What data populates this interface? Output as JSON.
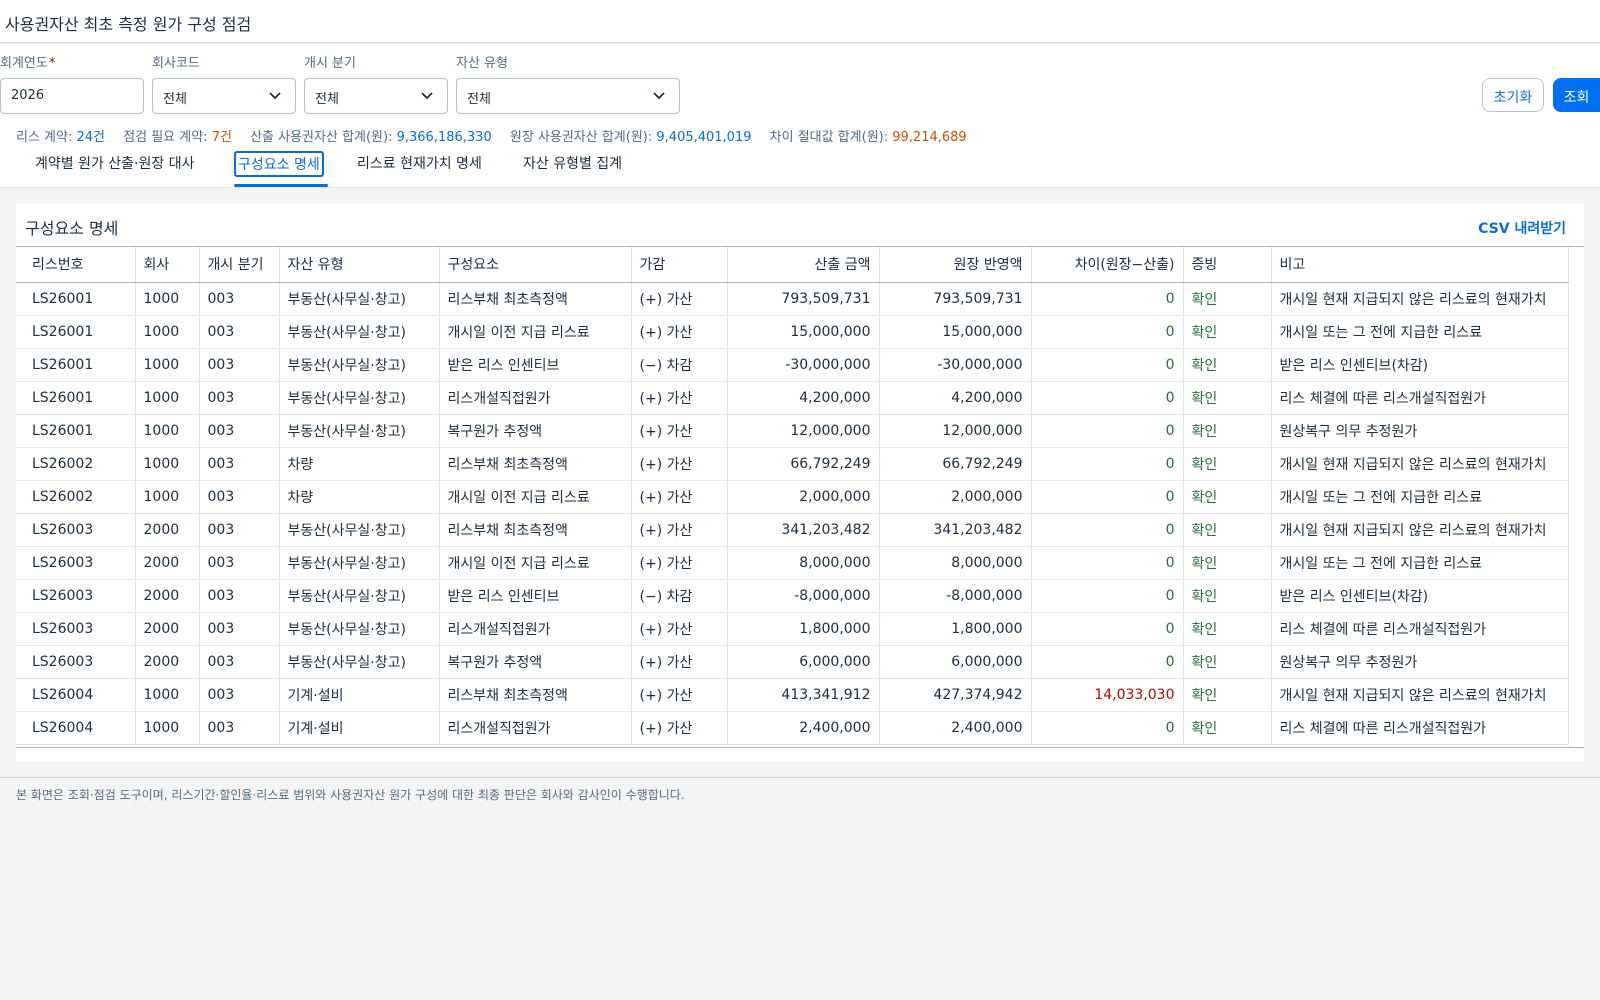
{
  "page": {
    "title": "사용권자산 최초 측정 원가 구성 점검"
  },
  "filters": {
    "year": {
      "label": "회계연도",
      "required_mark": "*",
      "value": "2026"
    },
    "company": {
      "label": "회사코드",
      "value": "전체"
    },
    "quarter": {
      "label": "개시 분기",
      "value": "전체"
    },
    "asset_type": {
      "label": "자산 유형",
      "value": "전체"
    },
    "reset_label": "초기화",
    "search_label": "조회"
  },
  "summary": {
    "contracts_label": "리스 계약:",
    "contracts_value": "24건",
    "check_label": "점검 필요 계약:",
    "check_value": "7건",
    "computed_label": "산출 사용권자산 합계(원):",
    "computed_value": "9,366,186,330",
    "ledger_label": "원장 사용권자산 합계(원):",
    "ledger_value": "9,405,401,019",
    "absdiff_label": "차이 절대값 합계(원):",
    "absdiff_value": "99,214,689"
  },
  "tabs": [
    {
      "label": "계약별 원가 산출·원장 대사"
    },
    {
      "label": "구성요소 명세"
    },
    {
      "label": "리스료 현재가치 명세"
    },
    {
      "label": "자산 유형별 집계"
    }
  ],
  "panel": {
    "title": "구성요소 명세",
    "csv_label": "CSV 내려받기"
  },
  "table": {
    "headers": [
      "리스번호",
      "회사",
      "개시 분기",
      "자산 유형",
      "구성요소",
      "가감",
      "산출 금액",
      "원장 반영액",
      "차이(원장−산출)",
      "증빙",
      "비고"
    ],
    "rows": [
      [
        "LS26001",
        "1000",
        "003",
        "부동산(사무실·창고)",
        "리스부채 최초측정액",
        "(+) 가산",
        "793,509,731",
        "793,509,731",
        "0",
        "확인",
        "개시일 현재 지급되지 않은 리스료의 현재가치"
      ],
      [
        "LS26001",
        "1000",
        "003",
        "부동산(사무실·창고)",
        "개시일 이전 지급 리스료",
        "(+) 가산",
        "15,000,000",
        "15,000,000",
        "0",
        "확인",
        "개시일 또는 그 전에 지급한 리스료"
      ],
      [
        "LS26001",
        "1000",
        "003",
        "부동산(사무실·창고)",
        "받은 리스 인센티브",
        "(−) 차감",
        "-30,000,000",
        "-30,000,000",
        "0",
        "확인",
        "받은 리스 인센티브(차감)"
      ],
      [
        "LS26001",
        "1000",
        "003",
        "부동산(사무실·창고)",
        "리스개설직접원가",
        "(+) 가산",
        "4,200,000",
        "4,200,000",
        "0",
        "확인",
        "리스 체결에 따른 리스개설직접원가"
      ],
      [
        "LS26001",
        "1000",
        "003",
        "부동산(사무실·창고)",
        "복구원가 추정액",
        "(+) 가산",
        "12,000,000",
        "12,000,000",
        "0",
        "확인",
        "원상복구 의무 추정원가"
      ],
      [
        "LS26002",
        "1000",
        "003",
        "차량",
        "리스부채 최초측정액",
        "(+) 가산",
        "66,792,249",
        "66,792,249",
        "0",
        "확인",
        "개시일 현재 지급되지 않은 리스료의 현재가치"
      ],
      [
        "LS26002",
        "1000",
        "003",
        "차량",
        "개시일 이전 지급 리스료",
        "(+) 가산",
        "2,000,000",
        "2,000,000",
        "0",
        "확인",
        "개시일 또는 그 전에 지급한 리스료"
      ],
      [
        "LS26003",
        "2000",
        "003",
        "부동산(사무실·창고)",
        "리스부채 최초측정액",
        "(+) 가산",
        "341,203,482",
        "341,203,482",
        "0",
        "확인",
        "개시일 현재 지급되지 않은 리스료의 현재가치"
      ],
      [
        "LS26003",
        "2000",
        "003",
        "부동산(사무실·창고)",
        "개시일 이전 지급 리스료",
        "(+) 가산",
        "8,000,000",
        "8,000,000",
        "0",
        "확인",
        "개시일 또는 그 전에 지급한 리스료"
      ],
      [
        "LS26003",
        "2000",
        "003",
        "부동산(사무실·창고)",
        "받은 리스 인센티브",
        "(−) 차감",
        "-8,000,000",
        "-8,000,000",
        "0",
        "확인",
        "받은 리스 인센티브(차감)"
      ],
      [
        "LS26003",
        "2000",
        "003",
        "부동산(사무실·창고)",
        "리스개설직접원가",
        "(+) 가산",
        "1,800,000",
        "1,800,000",
        "0",
        "확인",
        "리스 체결에 따른 리스개설직접원가"
      ],
      [
        "LS26003",
        "2000",
        "003",
        "부동산(사무실·창고)",
        "복구원가 추정액",
        "(+) 가산",
        "6,000,000",
        "6,000,000",
        "0",
        "확인",
        "원상복구 의무 추정원가"
      ],
      [
        "LS26004",
        "1000",
        "003",
        "기계·설비",
        "리스부채 최초측정액",
        "(+) 가산",
        "413,341,912",
        "427,374,942",
        "14,033,030",
        "확인",
        "개시일 현재 지급되지 않은 리스료의 현재가치"
      ],
      [
        "LS26004",
        "1000",
        "003",
        "기계·설비",
        "리스개설직접원가",
        "(+) 가산",
        "2,400,000",
        "2,400,000",
        "0",
        "확인",
        "리스 체결에 따른 리스개설직접원가"
      ]
    ]
  },
  "footer": {
    "note": "본 화면은 조회·점검 도구이며, 리스기간·할인율·리스료 범위와 사용권자산 원가 구성에 대한 최종 판단은 회사와 감사인이 수행합니다."
  }
}
